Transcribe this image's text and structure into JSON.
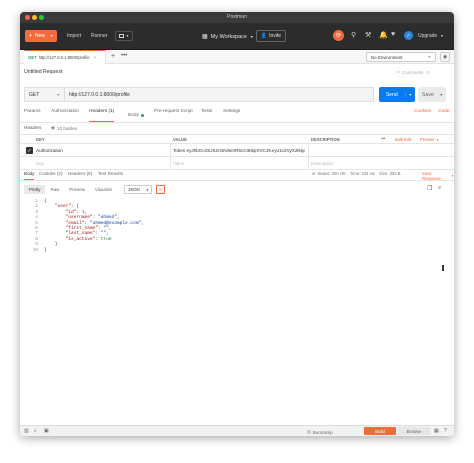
{
  "window": {
    "title": "Postman"
  },
  "toolbar": {
    "new_label": "New",
    "import_label": "Import",
    "runner_label": "Runner",
    "workspace_label": "My Workspace",
    "invite_label": "Invite",
    "upgrade_label": "Upgrade"
  },
  "request_tab": {
    "method": "GET",
    "url": "http://127.0.0.1:8000/profile"
  },
  "environment": {
    "selected": "No Environment"
  },
  "request": {
    "name": "Untitled Request",
    "comments_label": "Comments",
    "comments_count": "0",
    "method": "GET",
    "url": "http://127.0.0.1:8000/profile",
    "send_label": "Send",
    "save_label": "Save"
  },
  "req_tabs": {
    "params": "Params",
    "authorization": "Authorization",
    "headers": "Headers (1)",
    "body": "Body",
    "prescript": "Pre-request Script",
    "tests": "Tests",
    "settings": "Settings",
    "cookies": "Cookies",
    "code": "Code"
  },
  "headers_section": {
    "label": "Headers",
    "hidden_toggle": "10 hidden",
    "col_key": "KEY",
    "col_value": "VALUE",
    "col_description": "DESCRIPTION",
    "bulk_edit": "Bulk Edit",
    "presets": "Presets",
    "row_key": "Authorization",
    "row_value": "Token eyJhbGciOiJIUzI1NiIsInR5cCI6IkpXVCJ9.eyJ1c2VyX2lkIjoxLCJ...",
    "placeholder_key": "Key",
    "placeholder_value": "Value",
    "placeholder_description": "Description"
  },
  "response": {
    "tabs": {
      "body": "Body",
      "cookies": "Cookies (2)",
      "headers": "Headers (8)",
      "test_results": "Test Results"
    },
    "status": "Status: 200 OK",
    "time": "Time: 333 ms",
    "size": "Size: 352 B",
    "save_response": "Save Response",
    "view_modes": {
      "pretty": "Pretty",
      "raw": "Raw",
      "preview": "Preview",
      "visualize": "Visualize"
    },
    "format": "JSON",
    "lines": [
      "{",
      "    \"user\": {",
      "        \"id\": 1,",
      "        \"username\": \"ahmed\",",
      "        \"email\": \"ahmed@example.com\",",
      "        \"first_name\": \"\",",
      "        \"last_name\": \"\",",
      "        \"is_active\": true",
      "    }",
      "}"
    ],
    "line_numbers": [
      "1",
      "2",
      "3",
      "4",
      "5",
      "6",
      "7",
      "8",
      "9",
      "10"
    ]
  },
  "statusbar": {
    "bootcamp": "Bootcamp",
    "build": "Build",
    "browse": "Browse"
  },
  "colors": {
    "accent": "#f26b3a",
    "send": "#097bed",
    "toolbar": "#2c2c2c"
  }
}
